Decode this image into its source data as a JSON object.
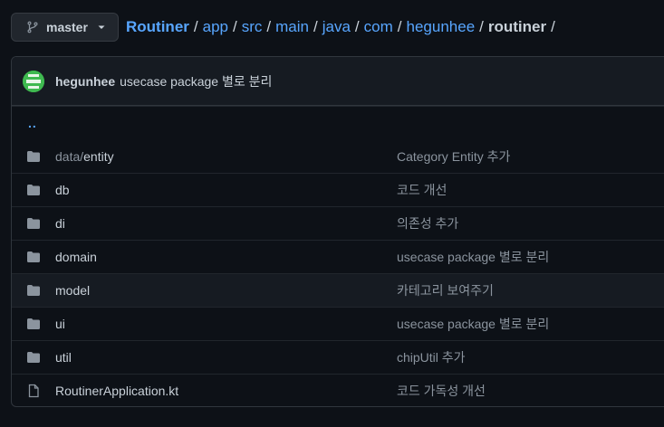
{
  "branch": {
    "label": "master",
    "icon": "git-branch-icon"
  },
  "breadcrumb": {
    "repo": "Routiner",
    "segments": [
      "app",
      "src",
      "main",
      "java",
      "com",
      "hegunhee"
    ],
    "current": "routiner",
    "separator": "/"
  },
  "commit": {
    "author": "hegunhee",
    "message": "usecase package 별로 분리"
  },
  "parent_link": "..",
  "files": [
    {
      "type": "folder",
      "name_prefix": "data/",
      "name": "entity",
      "message": "Category Entity 추가"
    },
    {
      "type": "folder",
      "name_prefix": "",
      "name": "db",
      "message": "코드 개선"
    },
    {
      "type": "folder",
      "name_prefix": "",
      "name": "di",
      "message": "의존성 추가"
    },
    {
      "type": "folder",
      "name_prefix": "",
      "name": "domain",
      "message": "usecase package 별로 분리"
    },
    {
      "type": "folder",
      "name_prefix": "",
      "name": "model",
      "message": "카테고리 보여주기"
    },
    {
      "type": "folder",
      "name_prefix": "",
      "name": "ui",
      "message": "usecase package 별로 분리"
    },
    {
      "type": "folder",
      "name_prefix": "",
      "name": "util",
      "message": "chipUtil 추가"
    },
    {
      "type": "file",
      "name_prefix": "",
      "name": "RoutinerApplication.kt",
      "message": "코드 가독성 개선"
    }
  ],
  "colors": {
    "background": "#0d1117",
    "link": "#58a6ff",
    "text": "#c9d1d9",
    "muted": "#8b949e"
  }
}
